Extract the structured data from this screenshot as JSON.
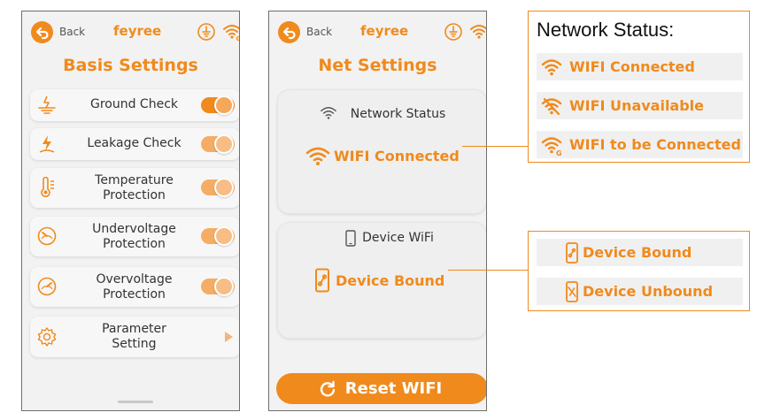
{
  "colors": {
    "accent": "#f08a1c",
    "panel": "#f2f2f2",
    "text": "#333333"
  },
  "topbar": {
    "back_label": "Back",
    "brand": "feyree",
    "icons": [
      "back-arrow-icon",
      "ground-plug-icon",
      "wifi-g-icon"
    ]
  },
  "basis": {
    "title": "Basis Settings",
    "rows": [
      {
        "label": "Ground Check",
        "icon": "ground-icon",
        "control": "toggle",
        "on": true
      },
      {
        "label": "Leakage Check",
        "icon": "lightning-icon",
        "control": "toggle",
        "on": true
      },
      {
        "label": "Temperature\nProtection",
        "icon": "thermometer-icon",
        "control": "toggle",
        "on": true
      },
      {
        "label": "Undervoltage\nProtection",
        "icon": "gauge-low-icon",
        "control": "toggle",
        "on": true
      },
      {
        "label": "Overvoltage\nProtection",
        "icon": "gauge-high-icon",
        "control": "toggle",
        "on": true
      },
      {
        "label": "Parameter\nSetting",
        "icon": "gear-icon",
        "control": "chevron"
      }
    ]
  },
  "net": {
    "title": "Net Settings",
    "network_card": {
      "heading": "Network Status",
      "status": "WIFI Connected"
    },
    "device_card": {
      "heading": "Device WiFi",
      "status": "Device Bound"
    },
    "reset_label": "Reset WIFI"
  },
  "network_legend": {
    "title": "Network Status:",
    "items": [
      {
        "label": "WIFI Connected",
        "icon": "wifi-icon"
      },
      {
        "label": "WIFI Unavailable",
        "icon": "wifi-off-icon"
      },
      {
        "label": "WIFI to be Connected",
        "icon": "wifi-pending-icon"
      }
    ]
  },
  "device_legend": {
    "items": [
      {
        "label": "Device Bound",
        "icon": "phone-link-icon"
      },
      {
        "label": "Device Unbound",
        "icon": "phone-unlink-icon"
      }
    ]
  }
}
